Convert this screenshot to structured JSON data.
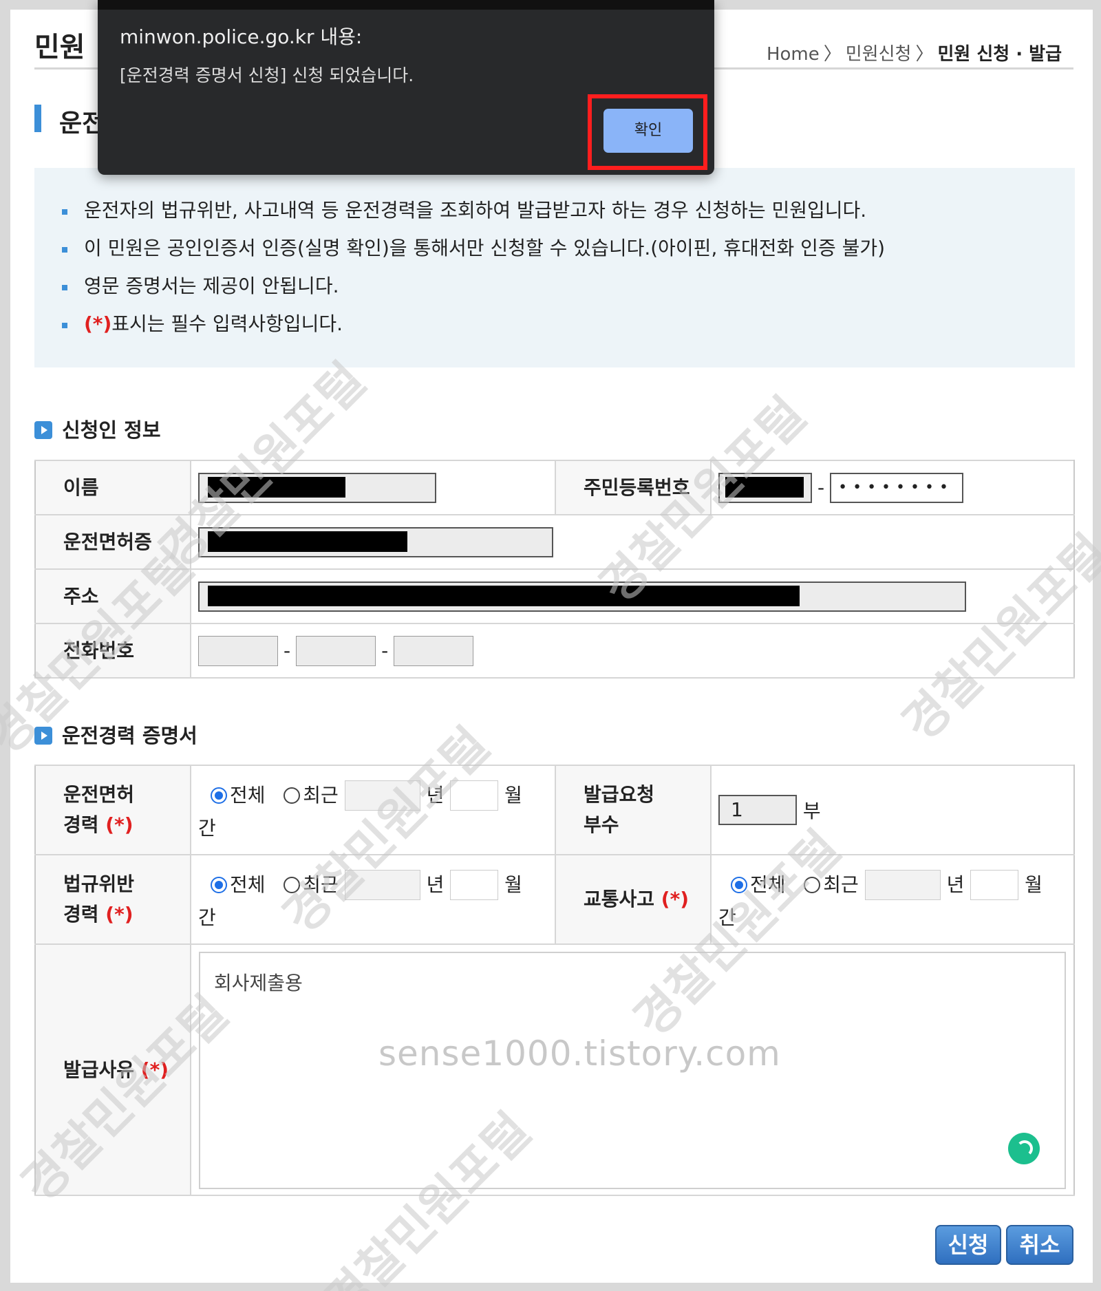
{
  "header": {
    "title": "민원",
    "breadcrumb": [
      "Home",
      "민원신청",
      "민원 신청 · 발급"
    ],
    "breadcrumb_sep": "〉"
  },
  "section_title": "운전",
  "notices": [
    "운전자의 법규위반, 사고내역 등 운전경력을 조회하여 발급받고자 하는 경우 신청하는 민원입니다.",
    "이 민원은 공인인증서 인증(실명 확인)을 통해서만 신청할 수 있습니다.(아이핀, 휴대전화 인증 불가)",
    "영문 증명서는 제공이 안됩니다.",
    "표시는 필수 입력사항입니다."
  ],
  "required_mark": "(*)",
  "applicant": {
    "heading": "신청인 정보",
    "name_label": "이름",
    "rrn_label": "주민등록번호",
    "rrn_back_masked": "••••••••",
    "license_label": "운전면허증",
    "address_label": "주소",
    "phone_label": "전화번호",
    "dash": "-"
  },
  "certificate": {
    "heading": "운전경력 증명서",
    "license_history_label_1": "운전면허",
    "license_history_label_2": "경력",
    "copies_label_1": "발급요청",
    "copies_label_2": "부수",
    "copies_value": "1",
    "copies_unit": "부",
    "violation_label_1": "법규위반",
    "violation_label_2": "경력",
    "accident_label": "교통사고",
    "opt_all": "전체",
    "opt_recent": "최근",
    "unit_year": "년",
    "unit_month": "월",
    "unit_period": "간",
    "reason_label": "발급사유",
    "reason_value": "회사제출용"
  },
  "buttons": {
    "submit": "신청",
    "cancel": "취소"
  },
  "dialog": {
    "title": "minwon.police.go.kr 내용:",
    "message": "[운전경력 증명서 신청] 신청 되었습니다.",
    "ok": "확인"
  },
  "watermark_site": "sense1000.tistory.com",
  "watermark_text": "경찰민원포털",
  "colors": {
    "accent": "#3c8fd8",
    "required": "#e02020",
    "dialog_bg": "#28292b",
    "dialog_button": "#8ab4f8",
    "highlight_frame": "#ff1e1e"
  }
}
